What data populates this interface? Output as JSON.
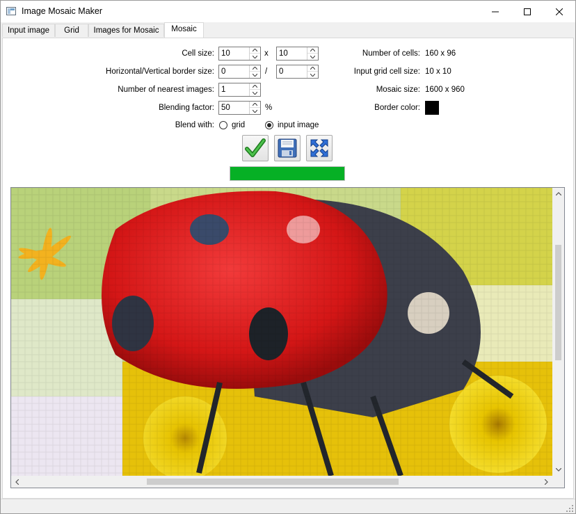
{
  "window": {
    "title": "Image Mosaic Maker",
    "controls": [
      "minimize-icon",
      "maximize-icon",
      "close-icon"
    ]
  },
  "tabs": [
    {
      "label": "Input image",
      "active": false
    },
    {
      "label": "Grid",
      "active": false
    },
    {
      "label": "Images for Mosaic",
      "active": false
    },
    {
      "label": "Mosaic",
      "active": true
    }
  ],
  "settings": {
    "cell_size_label": "Cell size:",
    "cell_w": "10",
    "cell_sep": "x",
    "cell_h": "10",
    "border_label": "Horizontal/Vertical border size:",
    "border_h": "0",
    "border_sep": "/",
    "border_v": "0",
    "nearest_label": "Number of nearest images:",
    "nearest": "1",
    "blend_label": "Blending factor:",
    "blend": "50",
    "blend_unit": "%",
    "blend_with_label": "Blend with:",
    "blend_options": [
      {
        "label": "grid",
        "checked": false
      },
      {
        "label": "input image",
        "checked": true
      }
    ]
  },
  "info": {
    "cells_label": "Number of cells:",
    "cells_value": "160 x 96",
    "grid_label": "Input grid cell size:",
    "grid_value": "10 x 10",
    "mosaic_label": "Mosaic size:",
    "mosaic_value": "1600 x 960",
    "border_color_label": "Border color:",
    "border_color": "#000000"
  },
  "actions": {
    "buttons": [
      "checkmark-icon",
      "save-icon",
      "fit-to-window-icon"
    ]
  },
  "progress": {
    "value": 1.0,
    "color": "#06b025"
  },
  "preview": {
    "description_icon": "mosaic-image"
  }
}
